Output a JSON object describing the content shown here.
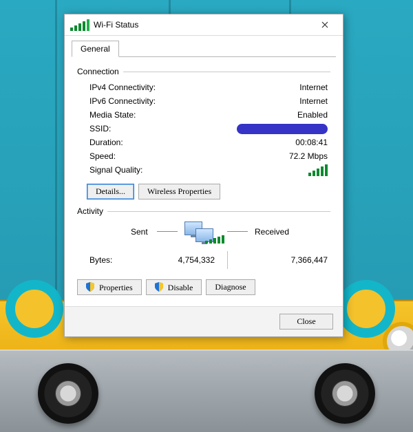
{
  "window": {
    "title": "Wi-Fi Status"
  },
  "tabs": {
    "general": "General"
  },
  "groups": {
    "connection": "Connection",
    "activity": "Activity"
  },
  "conn": {
    "ipv4_label": "IPv4 Connectivity:",
    "ipv4_value": "Internet",
    "ipv6_label": "IPv6 Connectivity:",
    "ipv6_value": "Internet",
    "media_label": "Media State:",
    "media_value": "Enabled",
    "ssid_label": "SSID:",
    "duration_label": "Duration:",
    "duration_value": "00:08:41",
    "speed_label": "Speed:",
    "speed_value": "72.2 Mbps",
    "signal_label": "Signal Quality:"
  },
  "buttons": {
    "details": "Details...",
    "wireless_props": "Wireless Properties",
    "properties": "Properties",
    "disable": "Disable",
    "diagnose": "Diagnose",
    "close": "Close"
  },
  "activity": {
    "sent_label": "Sent",
    "received_label": "Received",
    "bytes_label": "Bytes:",
    "bytes_sent": "4,754,332",
    "bytes_received": "7,366,447"
  },
  "icons": {
    "wifi": "wifi-icon",
    "close": "close-icon",
    "shield": "shield-icon",
    "monitors": "network-monitors-icon"
  }
}
